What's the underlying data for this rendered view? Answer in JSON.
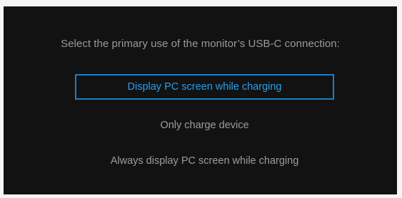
{
  "dialog": {
    "prompt": "Select the primary use of the monitor’s USB-C connection:",
    "options": [
      {
        "label": "Display PC screen while charging",
        "selected": true
      },
      {
        "label": "Only charge device",
        "selected": false
      },
      {
        "label": "Always display PC screen while charging",
        "selected": false
      }
    ]
  },
  "colors": {
    "background": "#121212",
    "text": "#9c9c9c",
    "accent": "#1b7fc4"
  }
}
